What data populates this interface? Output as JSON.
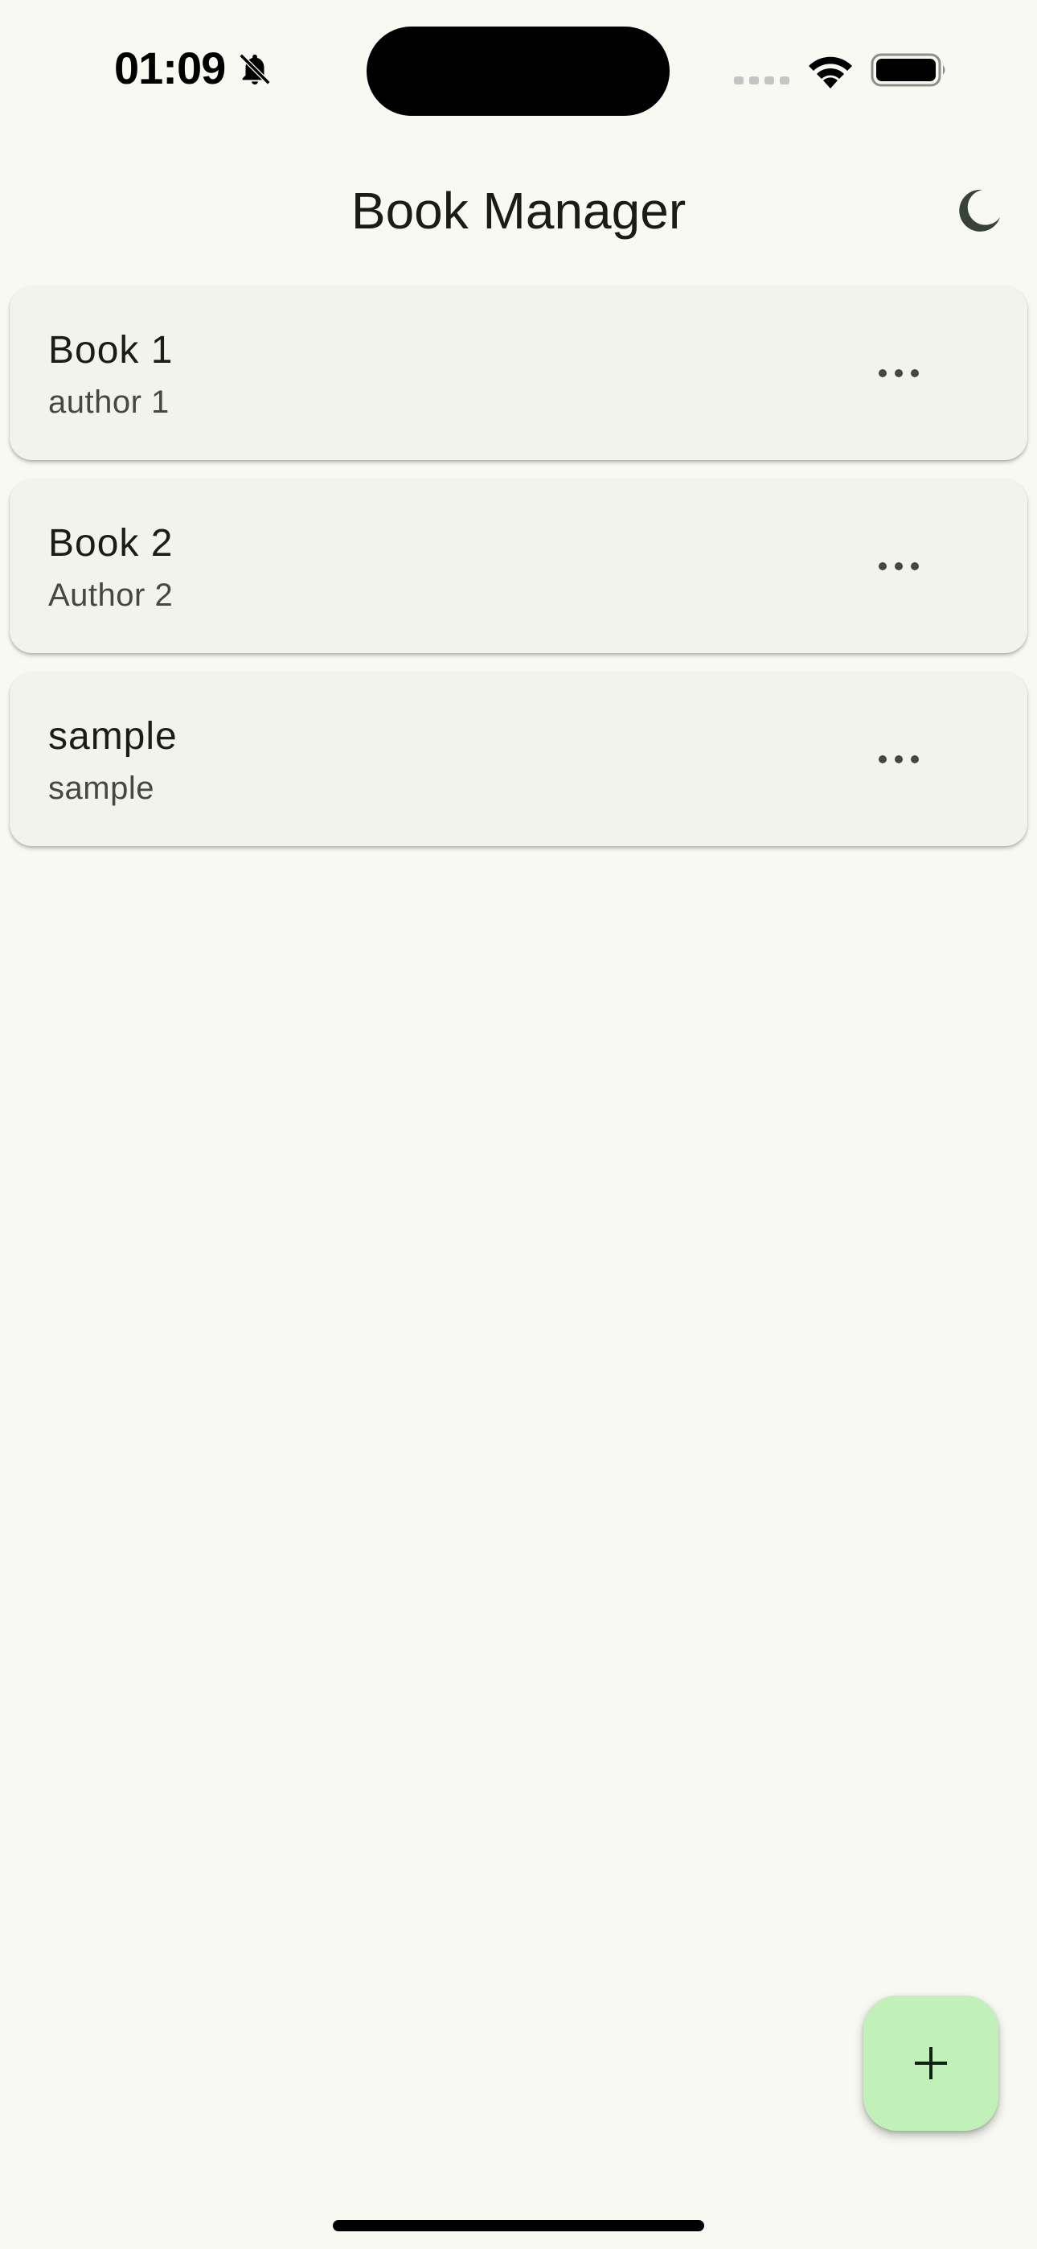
{
  "status_bar": {
    "time": "01:09",
    "icons": [
      "bell-off-icon",
      "cellular-signal-icon",
      "wifi-icon",
      "battery-icon"
    ]
  },
  "app_bar": {
    "title": "Book Manager",
    "theme_toggle_icon": "moon-icon"
  },
  "books": [
    {
      "title": "Book 1",
      "author": "author 1",
      "menu_icon": "more-horizontal-icon"
    },
    {
      "title": "Book 2",
      "author": "Author 2",
      "menu_icon": "more-horizontal-icon"
    },
    {
      "title": "sample",
      "author": "sample",
      "menu_icon": "more-horizontal-icon"
    }
  ],
  "fab": {
    "icon": "plus-icon"
  },
  "colors": {
    "background": "#f7f9f2",
    "card": "#f1f3ec",
    "fab": "#c1f0b9",
    "text_primary": "#1a1c18",
    "text_secondary": "#44483f"
  }
}
